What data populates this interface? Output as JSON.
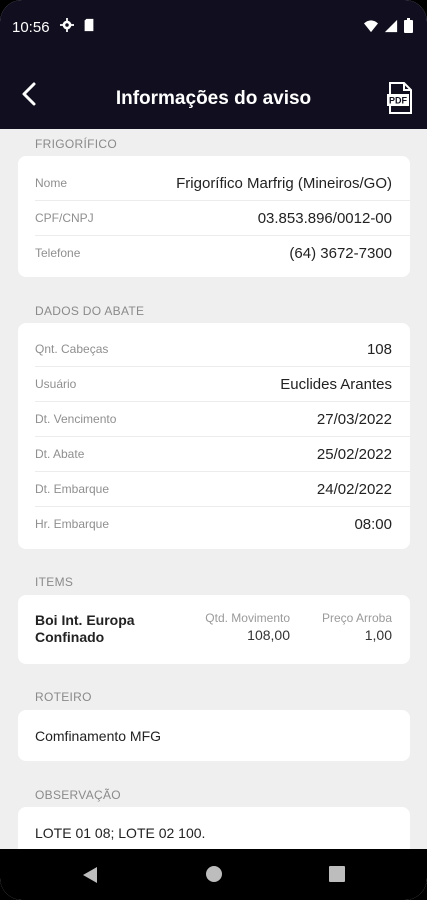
{
  "status_bar": {
    "time": "10:56"
  },
  "header": {
    "title": "Informações do aviso"
  },
  "frigorifico": {
    "section_label": "FRIGORÍFICO",
    "rows": [
      {
        "label": "Nome",
        "value": "Frigorífico Marfrig (Mineiros/GO)"
      },
      {
        "label": "CPF/CNPJ",
        "value": "03.853.896/0012-00"
      },
      {
        "label": "Telefone",
        "value": "(64) 3672-7300"
      }
    ]
  },
  "dados_abate": {
    "section_label": "DADOS DO ABATE",
    "rows": [
      {
        "label": "Qnt. Cabeças",
        "value": "108"
      },
      {
        "label": "Usuário",
        "value": "Euclides Arantes"
      },
      {
        "label": "Dt. Vencimento",
        "value": "27/03/2022"
      },
      {
        "label": "Dt. Abate",
        "value": "25/02/2022"
      },
      {
        "label": "Dt. Embarque",
        "value": "24/02/2022"
      },
      {
        "label": "Hr. Embarque",
        "value": "08:00"
      }
    ]
  },
  "items": {
    "section_label": "ITEMS",
    "item_name": "Boi Int. Europa Confinado",
    "qtd_label": "Qtd. Movimento",
    "qtd_value": "108,00",
    "preco_label": "Preço Arroba",
    "preco_value": "1,00"
  },
  "roteiro": {
    "section_label": "ROTEIRO",
    "value": "Comfinamento MFG"
  },
  "observacao": {
    "section_label": "OBSERVAÇÃO",
    "value": "LOTE 01 08; LOTE 02 100."
  },
  "icons": {
    "back": "chevron-left-icon",
    "pdf": "pdf-file-icon",
    "nav_back": "triangle-back-icon",
    "nav_home": "circle-home-icon",
    "nav_recents": "square-recents-icon"
  }
}
